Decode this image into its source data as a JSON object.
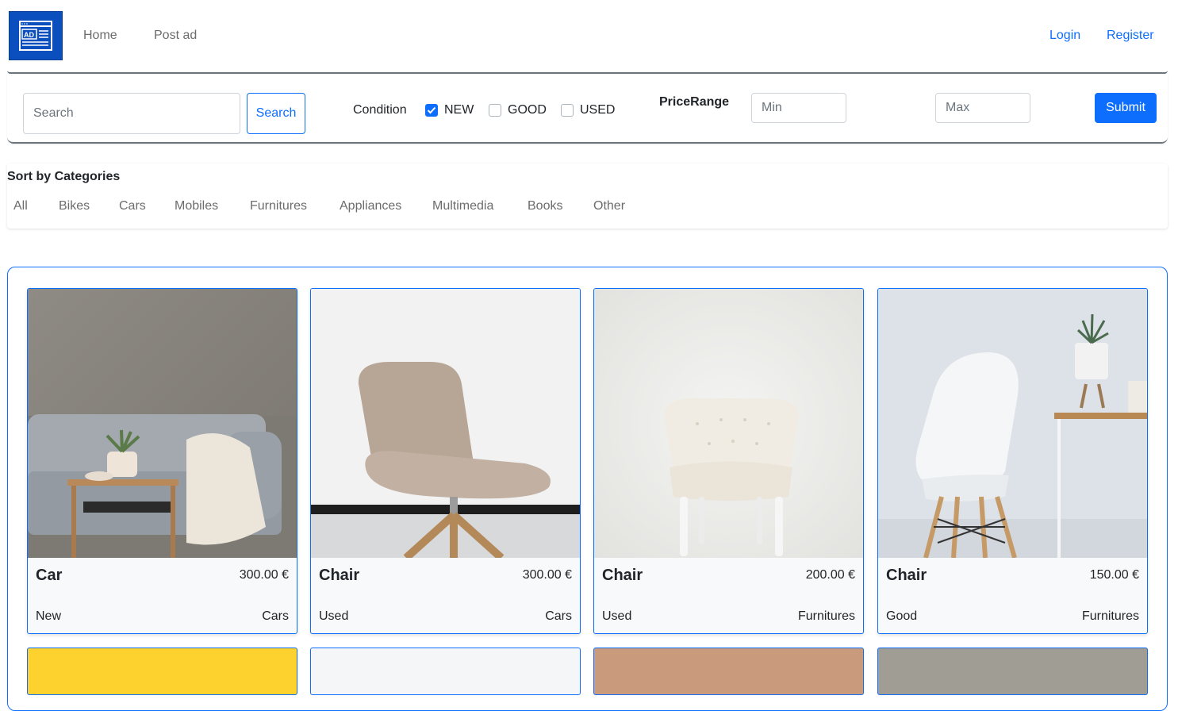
{
  "navbar": {
    "logo_icon": "ad-browser-icon",
    "links": [
      "Home",
      "Post ad"
    ],
    "login": "Login",
    "register": "Register"
  },
  "filters": {
    "search_placeholder": "Search",
    "search_button": "Search",
    "condition_label": "Condition",
    "conditions": [
      {
        "label": "NEW",
        "checked": true
      },
      {
        "label": "GOOD",
        "checked": false
      },
      {
        "label": "USED",
        "checked": false
      }
    ],
    "price_label": "PriceRange",
    "min_placeholder": "Min",
    "max_placeholder": "Max",
    "submit": "Submit"
  },
  "categories": {
    "title": "Sort by Categories",
    "items": [
      "All",
      "Bikes",
      "Cars",
      "Mobiles",
      "Furnitures",
      "Appliances",
      "Multimedia",
      "Books",
      "Other"
    ]
  },
  "listings": [
    {
      "title": "Car",
      "price": "300.00 €",
      "condition": "New",
      "category": "Cars"
    },
    {
      "title": "Chair",
      "price": "300.00 €",
      "condition": "Used",
      "category": "Cars"
    },
    {
      "title": "Chair",
      "price": "200.00 €",
      "condition": "Used",
      "category": "Furnitures"
    },
    {
      "title": "Chair",
      "price": "150.00 €",
      "condition": "Good",
      "category": "Furnitures"
    }
  ],
  "colors": {
    "primary": "#0d6efd",
    "logo_bg": "#0b4fbf",
    "row2_colors": [
      "#fdd12e",
      "#f4f6f8",
      "#c99a7c",
      "#9f9d94"
    ]
  }
}
